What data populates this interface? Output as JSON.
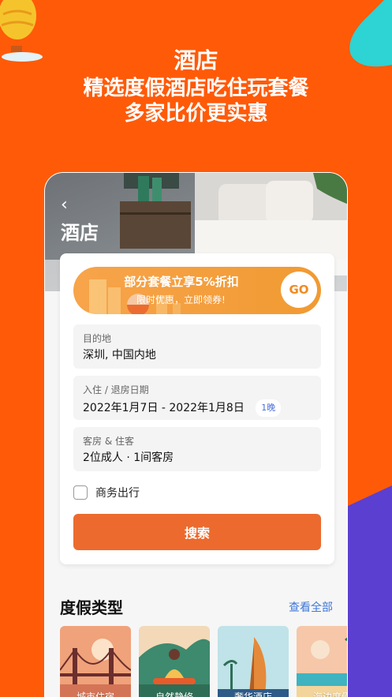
{
  "promo": {
    "title": "酒店",
    "line1": "精选度假酒店吃住玩套餐",
    "line2": "多家比价更实惠"
  },
  "header": {
    "back_icon": "chevron-left-icon",
    "title": "酒店"
  },
  "coupon": {
    "main": "部分套餐立享5%折扣",
    "sub": "限时优惠，立即领券!",
    "go": "GO"
  },
  "search": {
    "destination_label": "目的地",
    "destination_value": "深圳, 中国内地",
    "dates_label": "入住 / 退房日期",
    "dates_value": "2022年1月7日 - 2022年1月8日",
    "nights": "1晚",
    "guests_label": "客房 & 住客",
    "guests_value": "2位成人 · 1间客房",
    "business_label": "商务出行",
    "business_checked": false,
    "search_button": "搜索"
  },
  "categories": {
    "title": "度假类型",
    "view_all": "查看全部",
    "items": [
      {
        "label": "城市住宿"
      },
      {
        "label": "自然静修"
      },
      {
        "label": "奢华酒店"
      },
      {
        "label": "海边度假"
      }
    ]
  },
  "colors": {
    "brand_orange": "#FF5A08",
    "button_orange": "#EC6A2E",
    "accent_purple": "#5B3FD0",
    "accent_teal": "#2ED3D3",
    "link_blue": "#3E77D9"
  }
}
